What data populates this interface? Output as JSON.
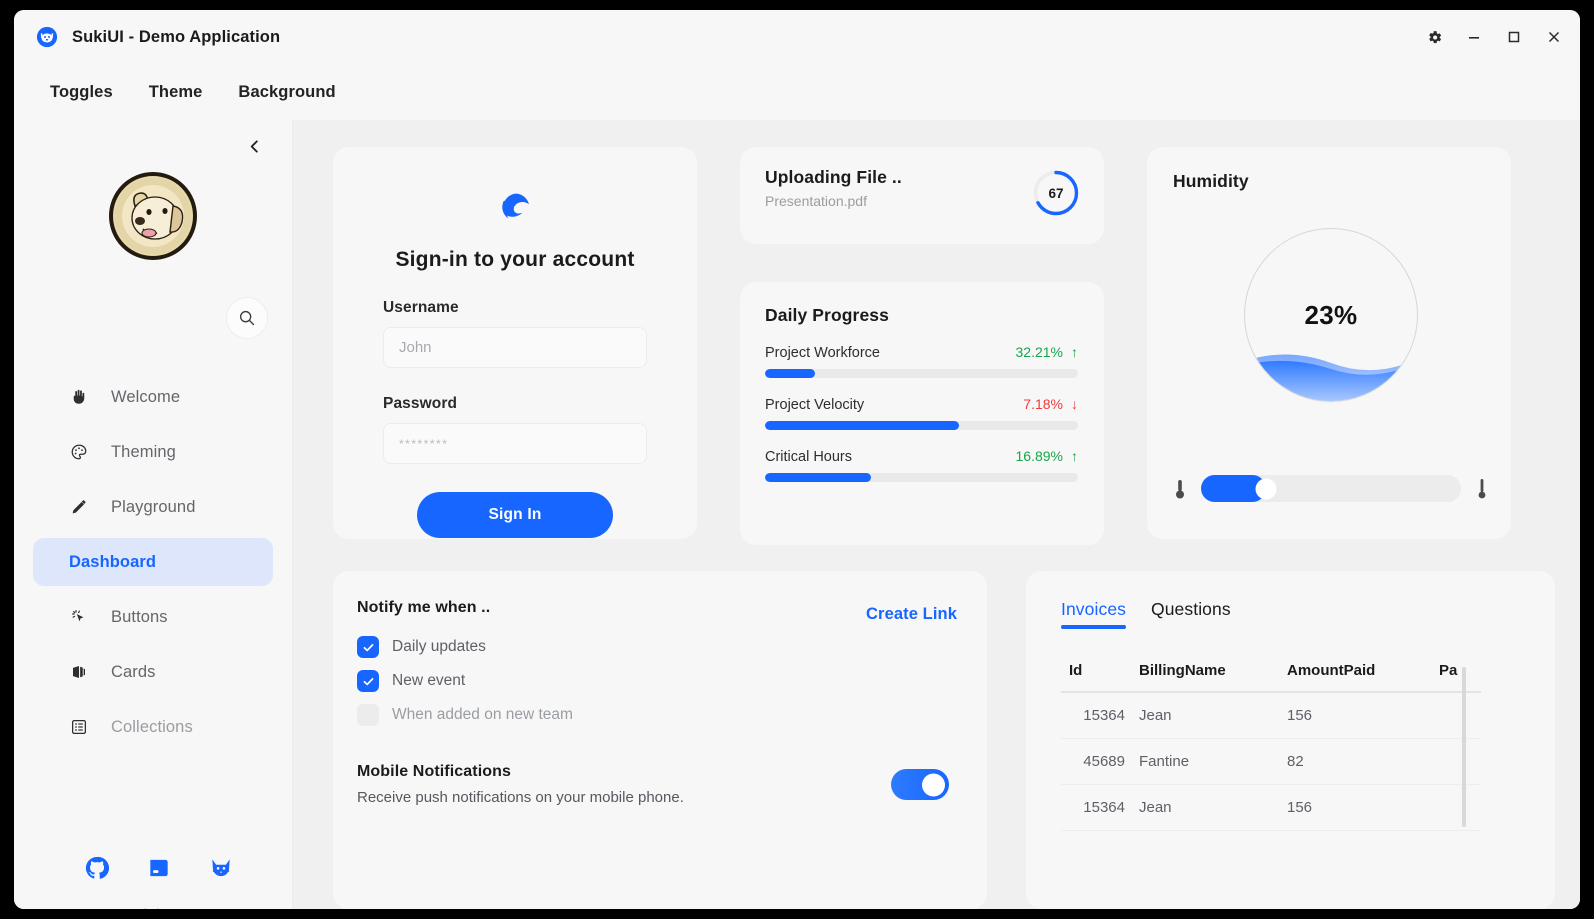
{
  "window": {
    "title": "SukiUI - Demo Application",
    "logo_icon": "dog-logo-icon",
    "controls": [
      {
        "name": "settings-button",
        "icon": "gear-icon"
      },
      {
        "name": "minimize-button",
        "icon": "minimize-icon"
      },
      {
        "name": "maximize-button",
        "icon": "maximize-icon"
      },
      {
        "name": "close-button",
        "icon": "close-icon"
      }
    ]
  },
  "menubar": {
    "items": [
      {
        "label": "Toggles"
      },
      {
        "label": "Theme"
      },
      {
        "label": "Background"
      }
    ]
  },
  "sidebar": {
    "collapse_icon": "chevron-left-icon",
    "avatar_alt": "dog-avatar",
    "search_icon": "search-icon",
    "scroll_hint_icon": "chevron-down-icon",
    "items": [
      {
        "label": "Welcome",
        "icon": "hand-wave-icon",
        "active": false,
        "faded": false,
        "glyph": "✋"
      },
      {
        "label": "Theming",
        "icon": "palette-icon",
        "active": false,
        "faded": false,
        "glyph": "🎨"
      },
      {
        "label": "Playground",
        "icon": "pencil-icon",
        "active": false,
        "faded": false,
        "glyph": "✎"
      },
      {
        "label": "Dashboard",
        "icon": "dashboard-icon",
        "active": true,
        "faded": false,
        "glyph": ""
      },
      {
        "label": "Buttons",
        "icon": "cursor-click-icon",
        "active": false,
        "faded": false,
        "glyph": "✦"
      },
      {
        "label": "Cards",
        "icon": "cards-icon",
        "active": false,
        "faded": false,
        "glyph": "❖"
      },
      {
        "label": "Collections",
        "icon": "list-icon",
        "active": false,
        "faded": true,
        "glyph": "☰"
      }
    ],
    "social": [
      {
        "name": "github-icon"
      },
      {
        "name": "docs-book-icon"
      },
      {
        "name": "cat-icon"
      }
    ]
  },
  "signin": {
    "brand_icon": "edge-logo-icon",
    "title": "Sign-in to your account",
    "username_label": "Username",
    "username_value": "",
    "username_placeholder": "John",
    "password_label": "Password",
    "password_value": "",
    "password_placeholder": "********",
    "submit_label": "Sign In"
  },
  "upload": {
    "title": "Uploading File ..",
    "filename": "Presentation.pdf",
    "progress": 67,
    "progress_label": "67"
  },
  "daily_progress": {
    "title": "Daily Progress",
    "items": [
      {
        "name": "Project Workforce",
        "percent": "32.21%",
        "direction": "up",
        "arrow": "↑",
        "bar": 16
      },
      {
        "name": "Project Velocity",
        "percent": "7.18%",
        "direction": "down",
        "arrow": "↓",
        "bar": 62
      },
      {
        "name": "Critical Hours",
        "percent": "16.89%",
        "direction": "up",
        "arrow": "↑",
        "bar": 34
      }
    ]
  },
  "humidity": {
    "title": "Humidity",
    "value_label": "23%",
    "value": 23,
    "slider_percent": 25,
    "icon_left": "thermometer-low-icon",
    "icon_right": "thermometer-high-icon"
  },
  "notify": {
    "title": "Notify me when ..",
    "create_link_label": "Create Link",
    "checkboxes": [
      {
        "label": "Daily updates",
        "checked": true
      },
      {
        "label": "New event",
        "checked": true
      },
      {
        "label": "When added on new team",
        "checked": false
      }
    ],
    "mobile_title": "Mobile Notifications",
    "mobile_subtitle": "Receive push notifications on your mobile phone.",
    "mobile_enabled": true
  },
  "invoices": {
    "tabs": [
      {
        "label": "Invoices",
        "active": true
      },
      {
        "label": "Questions",
        "active": false
      }
    ],
    "columns": [
      "Id",
      "BillingName",
      "AmountPaid",
      "Pa"
    ],
    "rows": [
      {
        "id": "15364",
        "billing_name": "Jean",
        "amount_paid": "156",
        "pa": ""
      },
      {
        "id": "45689",
        "billing_name": "Fantine",
        "amount_paid": "82",
        "pa": ""
      },
      {
        "id": "15364",
        "billing_name": "Jean",
        "amount_paid": "156",
        "pa": ""
      }
    ]
  },
  "colors": {
    "accent": "#1766ff",
    "accent_soft": "#dde6fb",
    "up": "#17a64a",
    "down": "#ef3b3b",
    "card": "#f7f7f7",
    "page": "#f0f0f0"
  }
}
